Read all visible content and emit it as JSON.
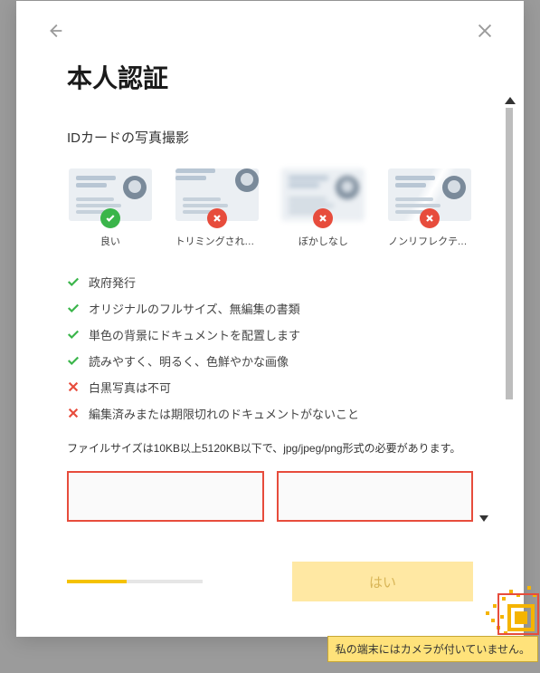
{
  "modal": {
    "title": "本人認証",
    "subtitle": "IDカードの写真撮影",
    "examples": [
      {
        "label": "良い",
        "status": "ok"
      },
      {
        "label": "トリミングされて...",
        "status": "bad"
      },
      {
        "label": "ぼかしなし",
        "status": "bad"
      },
      {
        "label": "ノンリフレクティブ",
        "status": "bad"
      }
    ],
    "rules": [
      {
        "ok": true,
        "text": "政府発行"
      },
      {
        "ok": true,
        "text": "オリジナルのフルサイズ、無編集の書類"
      },
      {
        "ok": true,
        "text": "単色の背景にドキュメントを配置します"
      },
      {
        "ok": true,
        "text": "読みやすく、明るく、色鮮やかな画像"
      },
      {
        "ok": false,
        "text": "白黒写真は不可"
      },
      {
        "ok": false,
        "text": "編集済みまたは期限切れのドキュメントがないこと"
      }
    ],
    "note": "ファイルサイズは10KB以上5120KB以下で、jpg/jpeg/png形式の必要があります。",
    "submit_label": "はい"
  },
  "tooltip": "私の端末にはカメラが付いていません。"
}
